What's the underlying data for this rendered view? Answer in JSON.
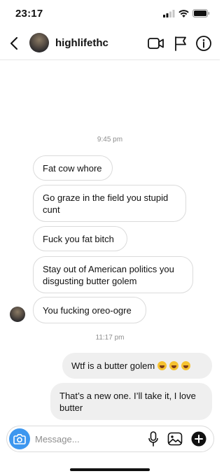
{
  "status_bar": {
    "time": "23:17"
  },
  "header": {
    "username": "highlifethc"
  },
  "conversation": {
    "timestamps": [
      "9:45 pm",
      "11:17 pm"
    ],
    "incoming": [
      {
        "text": "Fat cow whore"
      },
      {
        "text": "Go graze in the field you stupid cunt"
      },
      {
        "text": "Fuck you fat bitch"
      },
      {
        "text": "Stay out of American politics you disgusting butter golem"
      },
      {
        "text": "You fucking oreo-ogre"
      }
    ],
    "outgoing": [
      {
        "text": "Wtf is a butter golem",
        "emoji": [
          "laughing-with-tears",
          "laughing-with-tears",
          "laughing-with-tears"
        ]
      },
      {
        "text": "That’s a new one. I’ll take it, I love butter"
      }
    ]
  },
  "composer": {
    "placeholder": "Message...",
    "value": ""
  },
  "colors": {
    "accent": "#3d97ef",
    "bubble_out": "#efefef",
    "border": "#dbdbdb",
    "muted": "#8e8e8e"
  },
  "icons": [
    "cellular-signal-icon",
    "wifi-icon",
    "battery-icon",
    "back-chevron-icon",
    "video-call-icon",
    "flag-icon",
    "info-icon",
    "camera-icon",
    "microphone-icon",
    "gallery-icon",
    "plus-icon"
  ]
}
